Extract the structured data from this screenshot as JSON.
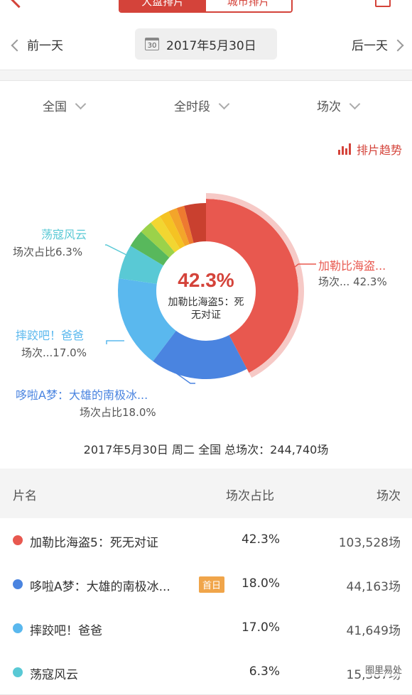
{
  "header": {
    "tabs": [
      "大盘排片",
      "城市排片"
    ],
    "active_tab": 0
  },
  "date_nav": {
    "prev": "前一天",
    "date": "2017年5月30日",
    "next": "后一天",
    "cal_day": "30"
  },
  "filters": [
    "全国",
    "全时段",
    "场次"
  ],
  "trend_link": "排片趋势",
  "donut": {
    "center_percent": "42.3%",
    "center_title": "加勒比海盗5：死无对证",
    "labels": [
      {
        "name": "加勒比海盗...",
        "sub": "场次... 42.3%",
        "color": "#e8584f"
      },
      {
        "name": "哆啦A梦：大雄的南极冰...",
        "sub": "场次占比18.0%",
        "color": "#4a84e0"
      },
      {
        "name": "摔跤吧！爸爸",
        "sub": "场次...17.0%",
        "color": "#5ab8ee"
      },
      {
        "name": "荡寇风云",
        "sub": "场次占比6.3%",
        "color": "#59c9d5"
      }
    ]
  },
  "chart_data": {
    "type": "pie",
    "series": [
      {
        "label": "加勒比海盗5：死无对证",
        "value": 42.3
      },
      {
        "label": "哆啦A梦：大雄的南极冰...",
        "value": 18.0
      },
      {
        "label": "摔跤吧！爸爸",
        "value": 17.0
      },
      {
        "label": "荡寇风云",
        "value": 6.3
      },
      {
        "label": "",
        "value": 3.2
      },
      {
        "label": "",
        "value": 2.4
      },
      {
        "label": "",
        "value": 2.0
      },
      {
        "label": "",
        "value": 1.8
      },
      {
        "label": "",
        "value": 1.6
      },
      {
        "label": "",
        "value": 1.4
      },
      {
        "label": "",
        "value": 4.0
      }
    ],
    "colors": [
      "#e8584f",
      "#4a84e0",
      "#5ab8ee",
      "#59c9d5",
      "#58b85c",
      "#9bd24a",
      "#f2d631",
      "#f5c323",
      "#f3a52a",
      "#ee7a30",
      "#c9402f"
    ]
  },
  "summary": "2017年5月30日 周二 全国  总场次：244,740场",
  "table": {
    "headers": [
      "片名",
      "场次占比",
      "场次"
    ],
    "rows": [
      {
        "name": "加勒比海盗5：死无对证",
        "pct": "42.3%",
        "count": "103,528场",
        "color": "#e8584f",
        "badge": ""
      },
      {
        "name": "哆啦A梦：大雄的南极冰...",
        "pct": "18.0%",
        "count": "44,163场",
        "color": "#4a84e0",
        "badge": "首日"
      },
      {
        "name": "摔跤吧！爸爸",
        "pct": "17.0%",
        "count": "41,649场",
        "color": "#5ab8ee",
        "badge": ""
      },
      {
        "name": "荡寇风云",
        "pct": "6.3%",
        "count": "15,387场",
        "color": "#59c9d5",
        "badge": ""
      }
    ]
  },
  "watermark": "圈里易处"
}
